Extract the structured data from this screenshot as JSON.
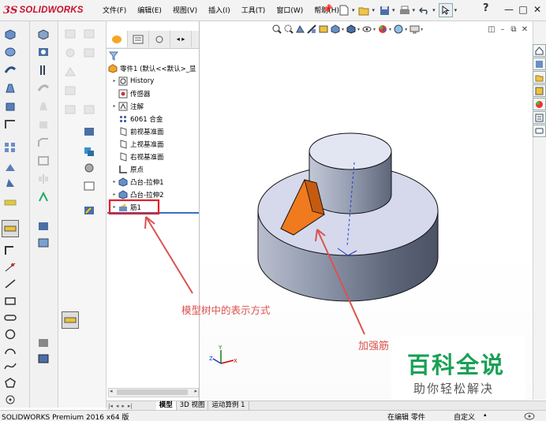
{
  "app": {
    "logo_ds": "3S",
    "logo_name": "SOLIDWORKS"
  },
  "menu": [
    {
      "label": "文件(F)"
    },
    {
      "label": "编辑(E)"
    },
    {
      "label": "视图(V)"
    },
    {
      "label": "插入(I)"
    },
    {
      "label": "工具(T)"
    },
    {
      "label": "窗口(W)"
    },
    {
      "label": "帮助(H)"
    }
  ],
  "window_controls": {
    "help": "?",
    "minimize": "—",
    "maximize": "□",
    "close": "✕"
  },
  "feature_tree": {
    "part_name": "零件1 (默认<<默认>_显",
    "items": [
      {
        "label": "History",
        "icon": "history-icon",
        "expander": "▸"
      },
      {
        "label": "传感器",
        "icon": "sensor-icon",
        "expander": ""
      },
      {
        "label": "注解",
        "icon": "annotation-icon",
        "expander": "▸"
      },
      {
        "label": "6061 合金",
        "icon": "material-icon",
        "expander": ""
      },
      {
        "label": "前视基准面",
        "icon": "plane-icon",
        "expander": ""
      },
      {
        "label": "上视基准面",
        "icon": "plane-icon",
        "expander": ""
      },
      {
        "label": "右视基准面",
        "icon": "plane-icon",
        "expander": ""
      },
      {
        "label": "原点",
        "icon": "origin-icon",
        "expander": ""
      },
      {
        "label": "凸台-拉伸1",
        "icon": "extrude-icon",
        "expander": "▸"
      },
      {
        "label": "凸台-拉伸2",
        "icon": "extrude-icon",
        "expander": "▸"
      },
      {
        "label": "筋1",
        "icon": "rib-icon",
        "expander": "▸"
      }
    ]
  },
  "bottom_tabs": [
    {
      "label": "模型",
      "active": true
    },
    {
      "label": "3D 视图",
      "active": false
    },
    {
      "label": "运动算例 1",
      "active": false
    }
  ],
  "status_bar": {
    "product": "SOLIDWORKS Premium 2016 x64 版",
    "mode": "在编辑 零件",
    "custom": "自定义"
  },
  "annotations": {
    "tree_label": "模型树中的表示方式",
    "rib_label": "加强筋"
  },
  "watermark": {
    "title": "百科全说",
    "subtitle": "助你轻松解决"
  },
  "colors": {
    "rib": "#f07a1e",
    "annotation": "#d9534f",
    "highlight_box": "#e0202b",
    "watermark_green": "#1aa055",
    "logo_red": "#c8102e"
  }
}
